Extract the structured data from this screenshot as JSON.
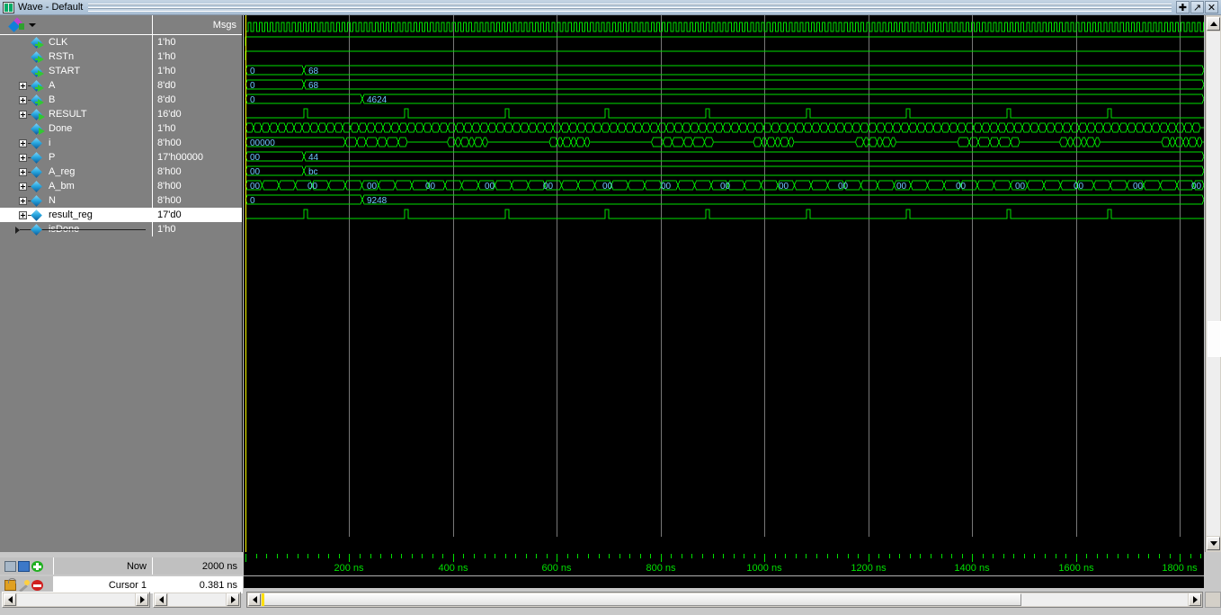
{
  "window": {
    "title": "Wave - Default",
    "app_icon": "wave-icon",
    "buttons": [
      {
        "name": "maximize-button",
        "glyph": "✚"
      },
      {
        "name": "undock-button",
        "glyph": "↗"
      },
      {
        "name": "close-button",
        "glyph": "✕"
      }
    ]
  },
  "columns": {
    "name_header": "",
    "msgs_header": "Msgs"
  },
  "signals": [
    {
      "name": "CLK",
      "value": "1'h0",
      "expandable": false,
      "kind": "in",
      "indent": 0,
      "selected": false,
      "wave": "clock"
    },
    {
      "name": "RSTn",
      "value": "1'h0",
      "expandable": false,
      "kind": "in",
      "indent": 0,
      "selected": false,
      "wave": "high-step"
    },
    {
      "name": "START",
      "value": "1'h0",
      "expandable": false,
      "kind": "in",
      "indent": 0,
      "selected": false,
      "wave": "high-step"
    },
    {
      "name": "A",
      "value": "8'd0",
      "expandable": true,
      "kind": "in",
      "indent": 0,
      "selected": false,
      "wave": "bus2",
      "bus": [
        {
          "t": 0,
          "label": "0"
        },
        {
          "t": 113,
          "label": "68"
        }
      ]
    },
    {
      "name": "B",
      "value": "8'd0",
      "expandable": true,
      "kind": "in",
      "indent": 0,
      "selected": false,
      "wave": "bus2",
      "bus": [
        {
          "t": 0,
          "label": "0"
        },
        {
          "t": 113,
          "label": "68"
        }
      ]
    },
    {
      "name": "RESULT",
      "value": "16'd0",
      "expandable": true,
      "kind": "out",
      "indent": 0,
      "selected": false,
      "wave": "bus2",
      "bus": [
        {
          "t": 0,
          "label": "0"
        },
        {
          "t": 226,
          "label": "4624"
        }
      ]
    },
    {
      "name": "Done",
      "value": "1'h0",
      "expandable": false,
      "kind": "out",
      "indent": 0,
      "selected": false,
      "wave": "pulses"
    },
    {
      "name": "i",
      "value": "8'h00",
      "expandable": true,
      "kind": "reg",
      "indent": 0,
      "selected": false,
      "wave": "dense-bus",
      "period": 9
    },
    {
      "name": "P",
      "value": "17'h00000",
      "expandable": true,
      "kind": "reg",
      "indent": 0,
      "selected": false,
      "wave": "sparse-bus",
      "bus": [
        {
          "t": 0,
          "label": "00000"
        }
      ]
    },
    {
      "name": "A_reg",
      "value": "8'h00",
      "expandable": true,
      "kind": "reg",
      "indent": 0,
      "selected": false,
      "wave": "bus2",
      "bus": [
        {
          "t": 0,
          "label": "00"
        },
        {
          "t": 113,
          "label": "44"
        }
      ]
    },
    {
      "name": "A_bm",
      "value": "8'h00",
      "expandable": true,
      "kind": "reg",
      "indent": 0,
      "selected": false,
      "wave": "bus2",
      "bus": [
        {
          "t": 0,
          "label": "00"
        },
        {
          "t": 113,
          "label": "bc"
        }
      ]
    },
    {
      "name": "N",
      "value": "8'h00",
      "expandable": true,
      "kind": "reg",
      "indent": 0,
      "selected": false,
      "wave": "n-bus",
      "label": "00",
      "period": 18
    },
    {
      "name": "result_reg",
      "value": "17'd0",
      "expandable": true,
      "kind": "reg",
      "indent": 0,
      "selected": true,
      "wave": "bus2",
      "bus": [
        {
          "t": 0,
          "label": "0"
        },
        {
          "t": 226,
          "label": "9248"
        }
      ]
    },
    {
      "name": "isDone",
      "value": "1'h0",
      "expandable": false,
      "kind": "reg",
      "indent": 1,
      "selected": false,
      "wave": "pulses"
    }
  ],
  "timeline": {
    "unit": "ns",
    "start": 0,
    "end": 1850,
    "major_interval": 200,
    "minor_interval": 20,
    "labels": [
      "200 ns",
      "400 ns",
      "600 ns",
      "800 ns",
      "1000 ns",
      "1200 ns",
      "1400 ns",
      "1600 ns",
      "1800 ns"
    ],
    "label_times": [
      200,
      400,
      600,
      800,
      1000,
      1200,
      1400,
      1600,
      1800
    ]
  },
  "status": {
    "now_label": "Now",
    "now_value": "2000 ns",
    "cursor_label": "Cursor 1",
    "cursor_value": "0.381 ns",
    "icons_row1": [
      "wave-icon",
      "message-icon",
      "add-cursor-icon"
    ],
    "icons_row2": [
      "lock-icon",
      "wrench-icon",
      "delete-cursor-icon"
    ]
  },
  "colors": {
    "wave_green": "#00e000",
    "bus_text": "#6ec8ff",
    "background": "#000000",
    "panel_gray": "#808080",
    "cursor_yellow": "#ffff00",
    "grid_gray": "#787878",
    "selected_row": "#ffffff"
  },
  "scrollbars": {
    "wave_h_thumb_pct": 82,
    "vertical_thumb_pos": "middle"
  }
}
